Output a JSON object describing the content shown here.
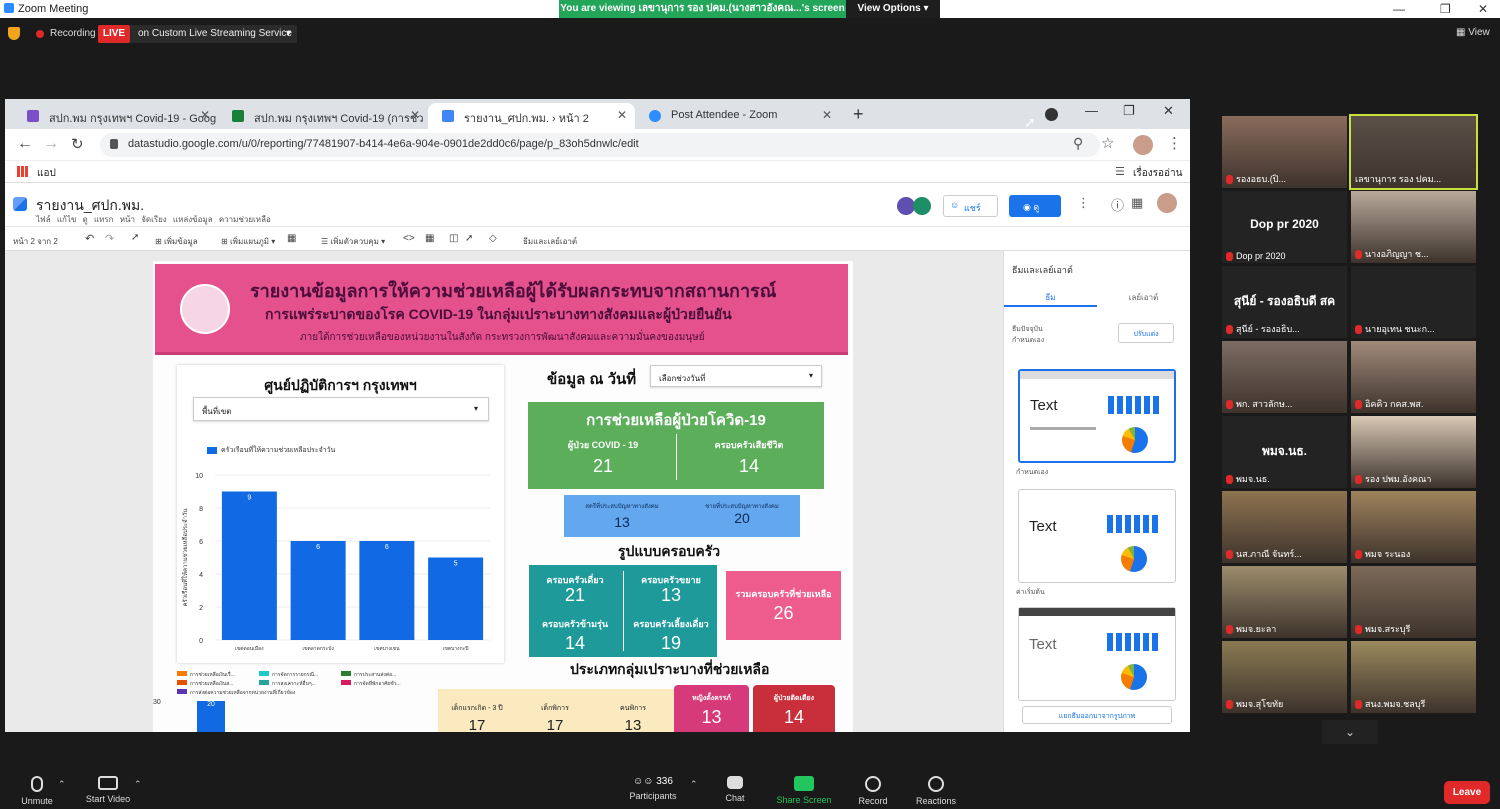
{
  "zoom": {
    "window_title": "Zoom Meeting",
    "banner": "You are viewing เลขานุการ รอง ปคม.(นางสาวอังคณ...'s screen",
    "view_options": "View Options",
    "recording": "Recording",
    "live": "LIVE",
    "live_service": "on Custom Live Streaming Service",
    "view": "View"
  },
  "browser": {
    "tabs": [
      {
        "label": "สปก.พม กรุงเทพฯ Covid-19 - Goog",
        "icon_color": "#7b4fc8"
      },
      {
        "label": "สปก.พม กรุงเทพฯ Covid-19 (การช่ว",
        "icon_color": "#188038"
      },
      {
        "label": "รายงาน_ศปก.พม. › หน้า 2",
        "icon_color": "#4285f4"
      },
      {
        "label": "Post Attendee - Zoom",
        "icon_color": "#2d8cff"
      }
    ],
    "url": "datastudio.google.com/u/0/reporting/77481907-b414-4e6a-904e-0901de2dd0c6/page/p_83oh5dnwlc/edit",
    "apps_label": "แอป",
    "reading_list": "เรื่องรออ่าน"
  },
  "datastudio": {
    "title": "รายงาน_ศปก.พม.",
    "menu": "ไฟล์ แก้ไข ดู แทรก หน้า จัดเรียง แหล่งข้อมูล ความช่วยเหลือ",
    "page_nav": "หน้า 2 จาก 2",
    "toolbar": {
      "add_data": "เพิ่มข้อมูล",
      "add_chart": "เพิ่มแผนภูมิ",
      "add_control": "เพิ่มตัวควบคุม",
      "theme_layout": "ธีมและเลย์เอาต์"
    },
    "share_label": "แชร์",
    "view_label": "ดู"
  },
  "report": {
    "header_line1": "รายงานข้อมูลการให้ความช่วยเหลือผู้ได้รับผลกระทบจากสถานการณ์",
    "header_line2": "การแพร่ระบาดของโรค COVID-19 ในกลุ่มเปราะบางทางสังคมและผู้ป่วยยืนยัน",
    "header_line3": "ภายใต้การช่วยเหลือของหน่วยงานในสังกัด กระทรวงการพัฒนาสังคมและความมั่นคงของมนุษย์",
    "center_title": "ศูนย์ปฏิบัติการฯ กรุงเทพฯ",
    "area_dropdown": "พื้นที่เขต",
    "date_label": "ข้อมูล ณ วันที่",
    "date_dropdown": "เลือกช่วงวันที่",
    "covid_box_title": "การช่วยเหลือผู้ป่วยโควิด-19",
    "covid_patients_label": "ผู้ป่วย COVID - 19",
    "covid_patients_value": "21",
    "covid_deaths_label": "ครอบครัวเสียชีวิต",
    "covid_deaths_value": "14",
    "female_label": "สตรีที่ประสบปัญหาทางสังคม",
    "female_value": "13",
    "male_label": "ชายที่ประสบปัญหาทางสังคม",
    "male_value": "20",
    "family_type_title": "รูปแบบครอบครัว",
    "single_label": "ครอบครัวเดี่ยว",
    "single_value": "21",
    "extended_label": "ครอบครัวขยาย",
    "extended_value": "13",
    "skipped_label": "ครอบครัวข้ามรุ่น",
    "skipped_value": "14",
    "singleparent_label": "ครอบครัวเลี้ยงเดี่ยว",
    "singleparent_value": "19",
    "total_label": "รวมครอบครัวที่ช่วยเหลือ",
    "total_value": "26",
    "vulnerable_title": "ประเภทกลุ่มเปราะบางที่ช่วยเหลือ",
    "groups": [
      {
        "label": "เด็กแรกเกิด - 3 ปี",
        "value": "17"
      },
      {
        "label": "เด็กพิการ",
        "value": "17"
      },
      {
        "label": "คนพิการ",
        "value": "13"
      },
      {
        "label": "หญิงตั้งครรภ์",
        "value": "13"
      },
      {
        "label": "ผู้ป่วยติดเตียง",
        "value": "14"
      }
    ],
    "legend_small": [
      "การช่วยเหลือเงินเรื่...",
      "การจัดการรายกรณี...",
      "การประสานส่งต่อ...",
      "การช่วยเหลือเงินส...",
      "การสงเคราะห์อื่นๆ...",
      "การจัดที่พักอาศัยชั่ว...",
      "การส่งต่อความช่วยเหลือจากหน่วยงานที่เกี่ยวข้อง"
    ],
    "bottom_value": "20",
    "bottom_axis": "30"
  },
  "chart_data": {
    "type": "bar",
    "categories": [
      "เขตดอนเมือง",
      "เขตลาดกระบัง",
      "เขตบางเขน",
      "เขตบางกะปิ"
    ],
    "series": [
      {
        "name": "ครัวเรือนที่ให้ความช่วยเหลือประจำวัน",
        "values": [
          9,
          6,
          6,
          5
        ]
      }
    ],
    "ylabel": "ครัวเรือนที่ให้ความช่วยเหลือประจำวัน",
    "ylim": [
      0,
      10
    ],
    "yticks": [
      0,
      2,
      4,
      6,
      8,
      10
    ],
    "bar_color": "#1269e4"
  },
  "theme_panel": {
    "title": "ธีมและเลย์เอาต์",
    "tab_theme": "ธีม",
    "tab_layout": "เลย์เอาต์",
    "current_theme_label": "ธีมปัจจุบัน",
    "current_theme_name": "กำหนดเอง",
    "customize": "ปรับแต่ง",
    "theme1_caption": "กำหนดเอง",
    "theme2_caption": "ค่าเริ่มต้น",
    "sample_text": "Text",
    "extract_button": "แยกธีมออกมาจากรูปภาพ"
  },
  "participants": [
    {
      "name": "รองอธบ.(ปิ...",
      "mode": "video",
      "muted": true
    },
    {
      "name": "เลขานุการ รอง ปคม...",
      "mode": "video",
      "muted": false,
      "highlight": true
    },
    {
      "name": "Dop pr 2020",
      "mode": "name",
      "display": "Dop pr 2020",
      "muted": true
    },
    {
      "name": "นางอภิญญา ช...",
      "mode": "video",
      "muted": true
    },
    {
      "name": "สุนีย์ - รองอธิบ...",
      "mode": "name",
      "display": "สุนีย์ - รองอธิบดี สค",
      "muted": true
    },
    {
      "name": "นายอุเทน ชนะก...",
      "mode": "blank",
      "muted": true
    },
    {
      "name": "พก. สาวลักษ...",
      "mode": "video",
      "muted": true
    },
    {
      "name": "อิคคิว กคส.พส.",
      "mode": "video",
      "muted": true
    },
    {
      "name": "พมจ.นธ.",
      "mode": "name",
      "display": "พมจ.นธ.",
      "muted": true
    },
    {
      "name": "รอง ปพม.อังคณา",
      "mode": "video",
      "muted": true
    },
    {
      "name": "นส.ภาณี จันทร์...",
      "mode": "video",
      "muted": true
    },
    {
      "name": "พมจ ระนอง",
      "mode": "video",
      "muted": true
    },
    {
      "name": "พมจ.ยะลา",
      "mode": "video",
      "muted": true
    },
    {
      "name": "พมจ.สระบุรี",
      "mode": "video",
      "muted": true
    },
    {
      "name": "พมจ.สุโขทัย",
      "mode": "video",
      "muted": true
    },
    {
      "name": "สนง.พมจ.ชลบุรี",
      "mode": "video",
      "muted": true
    }
  ],
  "controls": {
    "unmute": "Unmute",
    "start_video": "Start Video",
    "participants": "Participants",
    "participants_count": "336",
    "chat": "Chat",
    "share_screen": "Share Screen",
    "record": "Record",
    "reactions": "Reactions",
    "leave": "Leave"
  }
}
